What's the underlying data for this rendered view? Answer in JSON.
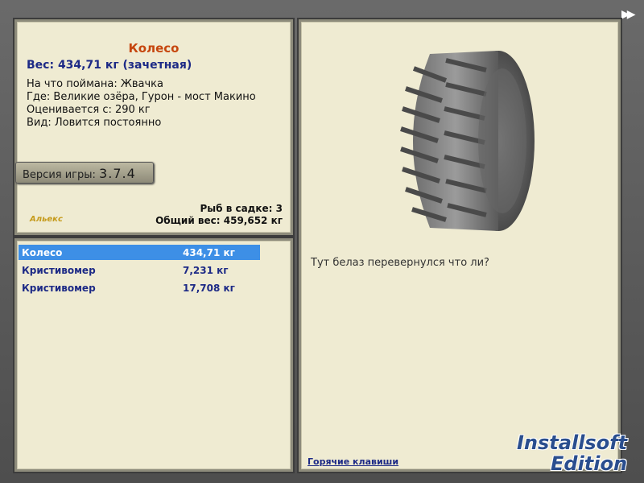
{
  "fish": {
    "name": "Колесо",
    "weight": "Вес: 434,71 кг (зачетная)",
    "caught_on": "На что поймана: Жвачка",
    "location": "Где: Великие озёра, Гурон - мост Макино",
    "valued_from": "Оценивается с: 290 кг",
    "type": "Вид: Ловится постоянно"
  },
  "version": {
    "label": "Версия игры:",
    "value": "3.7.4"
  },
  "summary": {
    "count": "Рыб в садке: 3",
    "total": "Общий вес: 459,652 кг"
  },
  "small_logo": "Альекс",
  "catch_list": [
    {
      "name": "Колесо",
      "weight": "434,71 кг",
      "selected": true
    },
    {
      "name": "Кристивомер",
      "weight": "7,231 кг",
      "selected": false
    },
    {
      "name": "Кристивомер",
      "weight": "17,708 кг",
      "selected": false
    }
  ],
  "comment": "Тут белаз перевернулся что ли?",
  "hotkeys_link": "Горячие клавиши",
  "nav_icon": "fast-forward-icon",
  "watermark": {
    "line1": "Installsoft",
    "line2": "Edition"
  },
  "colors": {
    "accent": "#c6460e",
    "link": "#1d2a86",
    "selection": "#3d8fe6",
    "panel": "#efebd2"
  }
}
